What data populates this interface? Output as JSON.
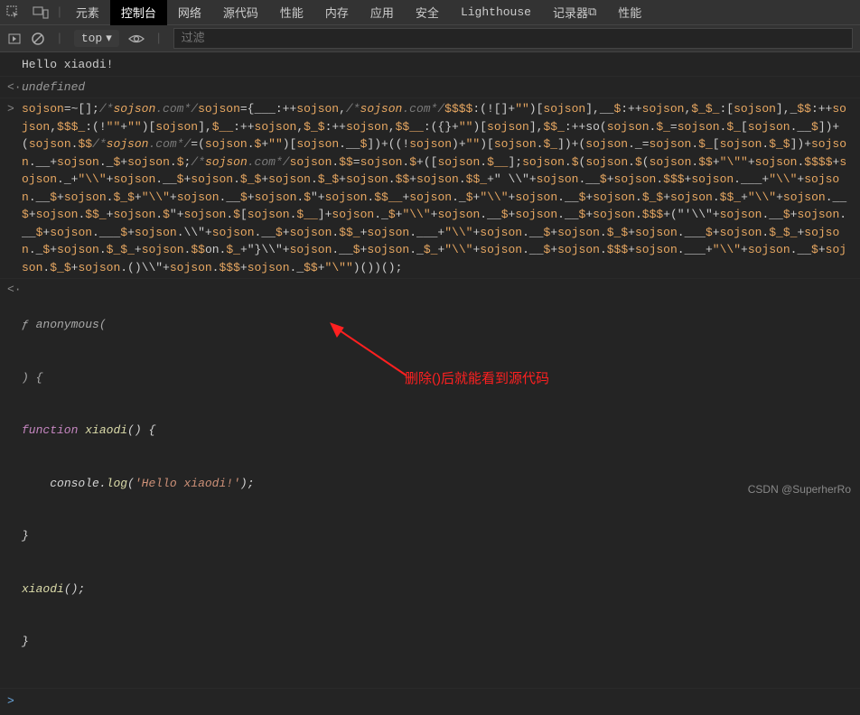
{
  "tabs": {
    "items": [
      "元素",
      "控制台",
      "网络",
      "源代码",
      "性能",
      "内存",
      "应用",
      "安全",
      "Lighthouse",
      "记录器",
      "性能"
    ],
    "recorder_badge": "⧉",
    "active_index": 1
  },
  "toolbar": {
    "context": "top",
    "filter_placeholder": "过滤"
  },
  "console": {
    "hello": "Hello xiaodi!",
    "undefined_label": "undefined",
    "obfuscated": "sojson=~[];/*sojson.com*/sojson={___:++sojson,/*sojson.com*/$$$$:(![]+\"\")[sojson],__$:++sojson,$_$_:[sojson],_$$:++sojson,$$$_:(!\"\"+\"\")[sojson],$__:++sojson,$_$:++sojson,$$__:({}+\"\")[sojson],$$_:++so(sojson.$_=sojson.$_[sojson.__$])+(sojson.$$/*sojson.com*/=(sojson.$+\"\")[sojson.__$])+((!sojson)+\"\")[sojson.$_])+(sojson._=sojson.$_[sojson.$_$])+sojson.__+sojson._$+sojson.$;/*sojson.com*/sojson.$$=sojson.$+([sojson.$__];sojson.$(sojson.$(sojson.$$+\"\\\"\"+sojson.$$$$+sojson._+\"\\\\\"+sojson.__$+sojson.$_$+sojson.$_$+sojson.$$+sojson.$$_+\" \\\\\"+sojson.__$+sojson.$$$+sojson.___+\"\\\\\"+sojson.__$+sojson.$_$+\"\\\\\"+sojson.__$+sojson.$\"+sojson.$$__+sojson._$+\"\\\\\"+sojson.__$+sojson.$_$+sojson.$$_+\"\\\\\"+sojson.__$+sojson.$$_+sojson.$\"+sojson.$[sojson.$__]+sojson._$+\"\\\\\"+sojson.__$+sojson.__$+sojson.$$$+(\"'\\\\\"+sojson.__$+sojson.__$+sojson.___$+sojson.\\\\\"+sojson.__$+sojson.$$_+sojson.___+\"\\\\\"+sojson.__$+sojson.$_$+sojson.___$+sojson.$_$_+sojson._$+sojson.$_$_+sojson.$$on.$_+\"}\\\\\"+sojson.__$+sojson._$_+\"\\\\\"+sojson.__$+sojson.$$$+sojson.___+\"\\\\\"+sojson.__$+sojson.$_$+sojson.()\\\\\"+sojson.$$$+sojson._$$+\"\\\"\")())();",
    "anon_result": {
      "l1": "ƒ anonymous(",
      "l2": ") {",
      "l3_kw": "function",
      "l3_name": "xiaodi",
      "l3_rest": "() {",
      "l4_a": "    console.",
      "l4_b": "log",
      "l4_c": "(",
      "l4_str": "'Hello xiaodi!'",
      "l4_d": ");",
      "l5": "}",
      "l6_a": "xiaodi",
      "l6_b": "();",
      "l7": "}"
    }
  },
  "annotation": {
    "text": "删除()后就能看到源代码"
  },
  "watermark": "CSDN @SuperherRo",
  "icons": {
    "inspect": "inspect-icon",
    "device": "device-icon",
    "play": "play-icon",
    "clear": "clear-icon",
    "eye": "eye-icon",
    "dropdown": "chevron-down-icon"
  }
}
